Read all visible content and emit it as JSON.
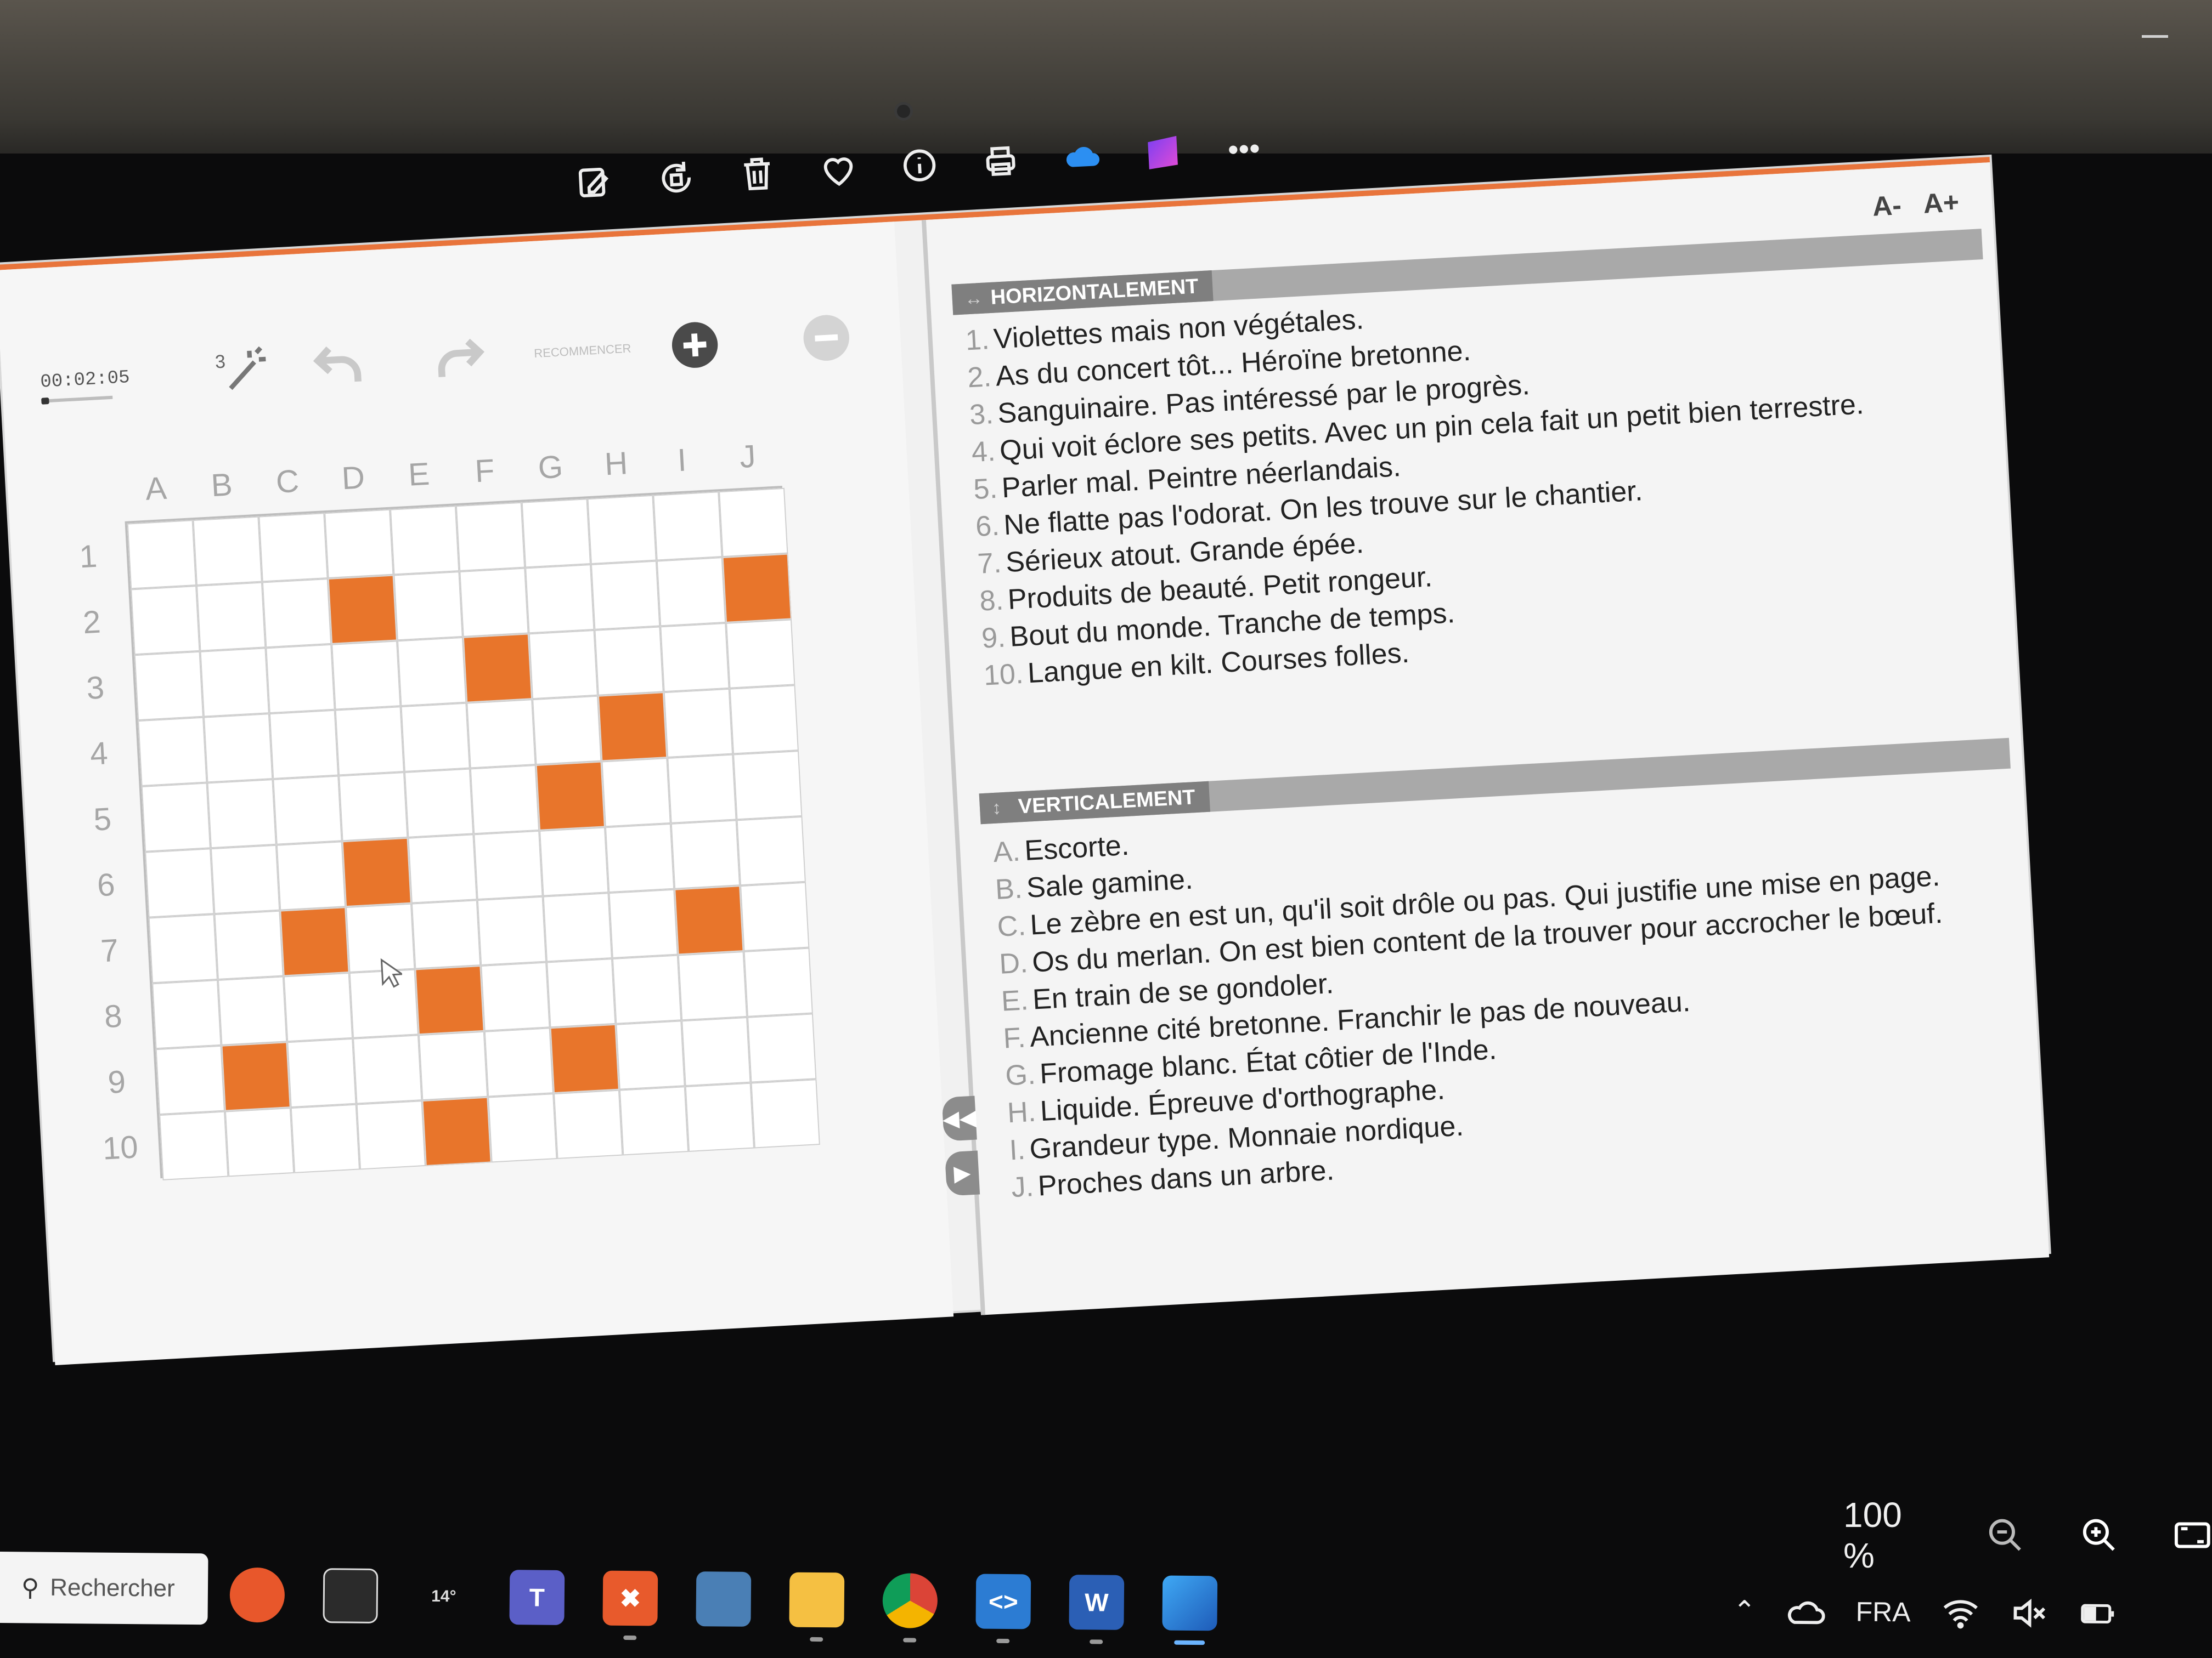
{
  "viewer_toolbar": {
    "icons": [
      "edit-image-icon",
      "rotate-icon",
      "delete-icon",
      "favorite-icon",
      "info-icon",
      "print-icon",
      "onedrive-icon",
      "clipchamp-icon",
      "more-icon"
    ],
    "more_glyph": "•••"
  },
  "game": {
    "timer": "00:02:05",
    "hints_remaining": "3",
    "reset_label": "RECOMMENCER"
  },
  "grid": {
    "columns": [
      "A",
      "B",
      "C",
      "D",
      "E",
      "F",
      "G",
      "H",
      "I",
      "J"
    ],
    "rows": [
      "1",
      "2",
      "3",
      "4",
      "5",
      "6",
      "7",
      "8",
      "9",
      "10"
    ],
    "black_cells": [
      [
        2,
        "D"
      ],
      [
        2,
        "J"
      ],
      [
        3,
        "F"
      ],
      [
        4,
        "H"
      ],
      [
        5,
        "G"
      ],
      [
        6,
        "D"
      ],
      [
        7,
        "C"
      ],
      [
        7,
        "I"
      ],
      [
        8,
        "E"
      ],
      [
        9,
        "B"
      ],
      [
        9,
        "G"
      ],
      [
        10,
        "E"
      ]
    ],
    "black_color": "#e8752b"
  },
  "font_controls": {
    "decrease": "A-",
    "increase": "A+"
  },
  "horizontal": {
    "title": "HORIZONTALEMENT",
    "clues": [
      {
        "num": "1.",
        "text": "Violettes mais non végétales."
      },
      {
        "num": "2.",
        "text": "As du concert tôt... Héroïne bretonne."
      },
      {
        "num": "3.",
        "text": "Sanguinaire. Pas intéressé par le progrès."
      },
      {
        "num": "4.",
        "text": "Qui voit éclore ses petits. Avec un pin cela fait un petit bien terrestre."
      },
      {
        "num": "5.",
        "text": "Parler mal. Peintre néerlandais."
      },
      {
        "num": "6.",
        "text": "Ne flatte pas l'odorat. On les trouve sur le chantier."
      },
      {
        "num": "7.",
        "text": "Sérieux atout. Grande épée."
      },
      {
        "num": "8.",
        "text": "Produits de beauté. Petit rongeur."
      },
      {
        "num": "9.",
        "text": "Bout du monde. Tranche de temps."
      },
      {
        "num": "10.",
        "text": "Langue en kilt. Courses folles."
      }
    ]
  },
  "vertical": {
    "title": "VERTICALEMENT",
    "clues": [
      {
        "num": "A.",
        "text": "Escorte."
      },
      {
        "num": "B.",
        "text": "Sale gamine."
      },
      {
        "num": "C.",
        "text": "Le zèbre en est un, qu'il soit drôle ou pas. Qui justifie une mise en page."
      },
      {
        "num": "D.",
        "text": "Os du merlan. On est bien content de la trouver pour accrocher le bœuf."
      },
      {
        "num": "E.",
        "text": "En train de se gondoler."
      },
      {
        "num": "F.",
        "text": "Ancienne cité bretonne. Franchir le pas de nouveau."
      },
      {
        "num": "G.",
        "text": "Fromage blanc. État côtier de l'Inde."
      },
      {
        "num": "H.",
        "text": "Liquide. Épreuve d'orthographe."
      },
      {
        "num": "I.",
        "text": "Grandeur type. Monnaie nordique."
      },
      {
        "num": "J.",
        "text": "Proches dans un arbre."
      }
    ]
  },
  "viewer_zoom": {
    "value": "100 %"
  },
  "taskbar": {
    "search_placeholder": "Rechercher",
    "weather": "14°",
    "language": "FRA",
    "word_letter": "W"
  }
}
